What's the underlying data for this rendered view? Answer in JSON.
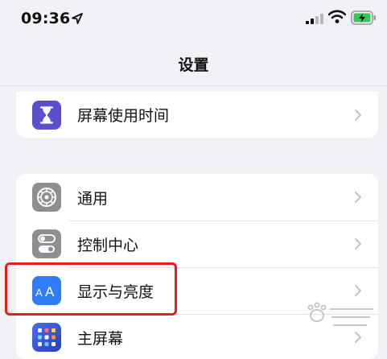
{
  "status_bar": {
    "time": "09:36",
    "location_icon": "location-arrow-icon",
    "signal_icon": "cellular-signal-icon",
    "wifi_icon": "wifi-icon",
    "battery_icon": "battery-charging-icon"
  },
  "nav": {
    "title": "设置"
  },
  "groups": [
    {
      "items": [
        {
          "label": "屏幕使用时间",
          "icon": "hourglass-icon",
          "icon_color": "#5b4fd0"
        }
      ]
    },
    {
      "items": [
        {
          "label": "通用",
          "icon": "gear-icon",
          "icon_color": "#8e8e93"
        },
        {
          "label": "控制中心",
          "icon": "toggles-icon",
          "icon_color": "#8e8e93"
        },
        {
          "label": "显示与亮度",
          "icon": "text-size-aa-icon",
          "icon_color": "#2f7cf6"
        },
        {
          "label": "主屏幕",
          "icon": "app-grid-icon",
          "icon_color": "#3b5bdb"
        }
      ]
    }
  ],
  "colors": {
    "background": "#f2f2f6",
    "highlight_border": "#e0201a",
    "battery_green": "#34c759"
  }
}
